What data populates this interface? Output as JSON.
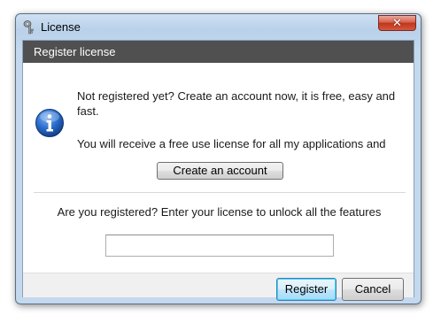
{
  "window": {
    "title": "License",
    "close_symbol": "✕"
  },
  "header": {
    "title": "Register license"
  },
  "body": {
    "message_1": "Not registered yet? Create an account now, it is free, easy and fast.",
    "message_2": "You will receive a free use license for all my applications and",
    "create_account_label": "Create an account",
    "message_3": "Are you registered? Enter your license to unlock all the features",
    "license_value": ""
  },
  "footer": {
    "register_label": "Register",
    "cancel_label": "Cancel"
  },
  "icons": {
    "app": "key-icon",
    "info": "info-icon",
    "close": "close-icon"
  },
  "colors": {
    "header_bg": "#505050",
    "header_text": "#ffffff",
    "info_blue": "#1d5fb8"
  }
}
